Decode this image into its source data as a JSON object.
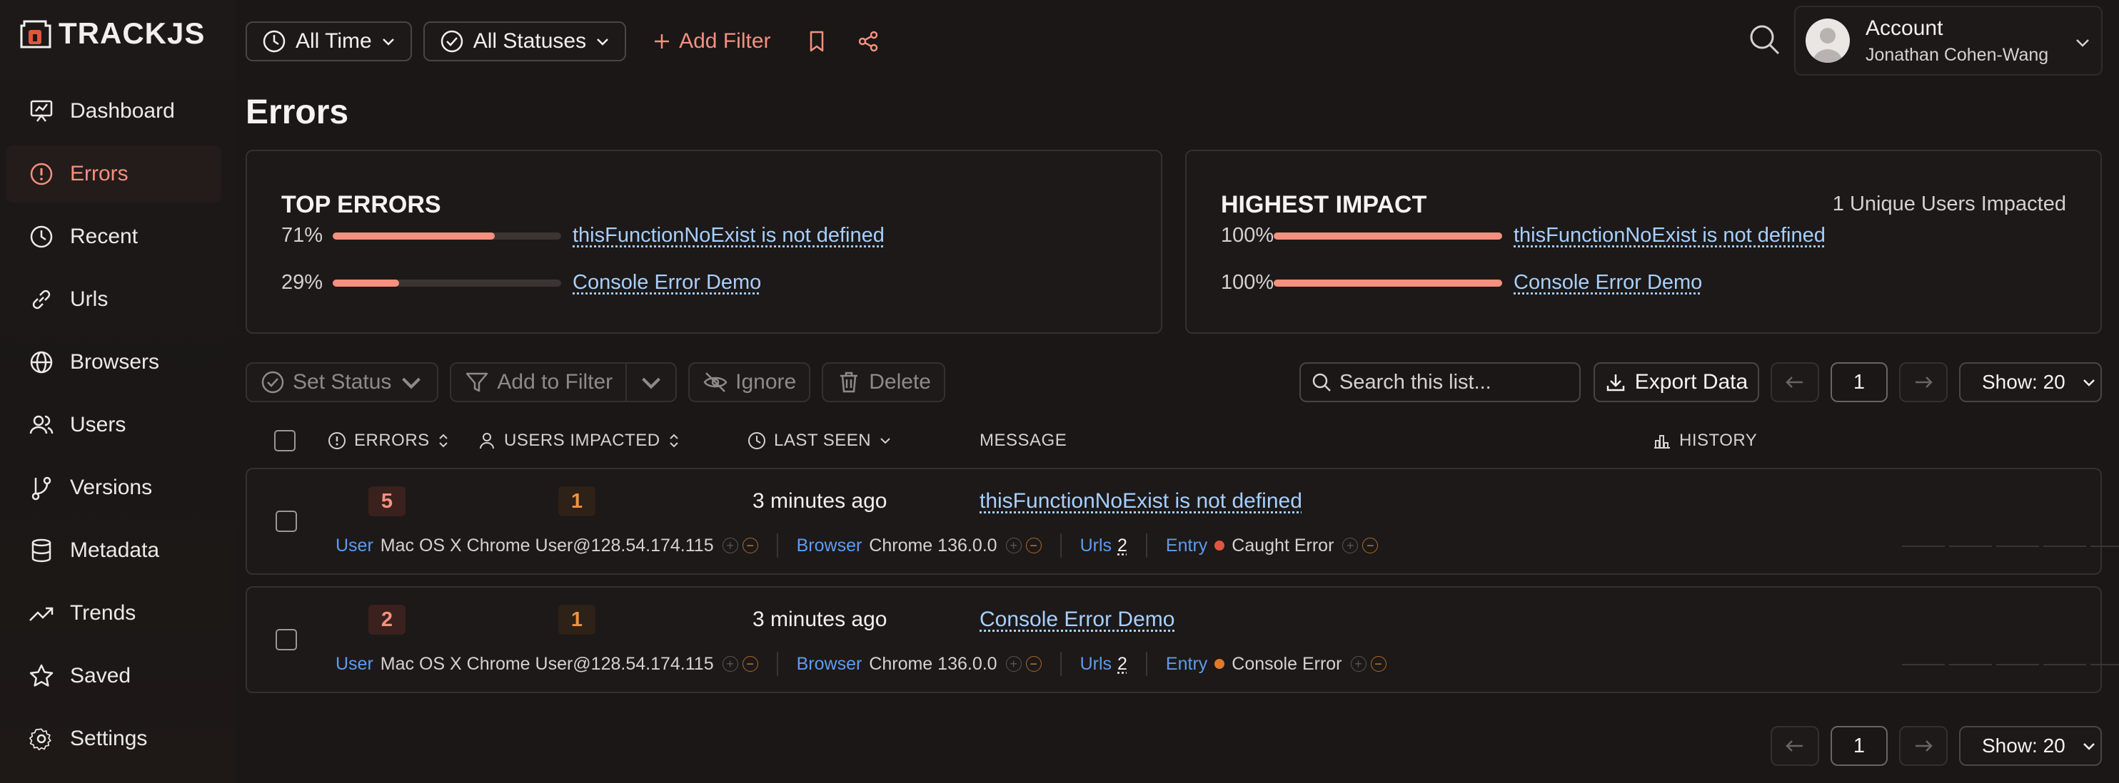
{
  "logo": {
    "text_track": "TRACK",
    "text_js": "JS"
  },
  "sidebar": {
    "items": [
      {
        "label": "Dashboard"
      },
      {
        "label": "Errors"
      },
      {
        "label": "Recent"
      },
      {
        "label": "Urls"
      },
      {
        "label": "Browsers"
      },
      {
        "label": "Users"
      },
      {
        "label": "Versions"
      },
      {
        "label": "Metadata"
      },
      {
        "label": "Trends"
      },
      {
        "label": "Saved"
      },
      {
        "label": "Settings"
      }
    ],
    "active": "Errors"
  },
  "topbar": {
    "time_filter": "All Time",
    "status_filter": "All Statuses",
    "add_filter": "Add Filter"
  },
  "account": {
    "title": "Account",
    "name": "Jonathan Cohen-Wang"
  },
  "page": {
    "title": "Errors"
  },
  "top_errors": {
    "title": "TOP ERRORS",
    "rows": [
      {
        "pct_label": "71%",
        "pct": 0.71,
        "label": "thisFunctionNoExist is not defined"
      },
      {
        "pct_label": "29%",
        "pct": 0.29,
        "label": "Console Error Demo"
      }
    ]
  },
  "highest_impact": {
    "title": "HIGHEST IMPACT",
    "subtitle": "1 Unique Users Impacted",
    "rows": [
      {
        "pct_label": "100%",
        "pct": 1.0,
        "label": "thisFunctionNoExist is not defined"
      },
      {
        "pct_label": "100%",
        "pct": 1.0,
        "label": "Console Error Demo"
      }
    ]
  },
  "toolbar": {
    "set_status": "Set Status",
    "add_to_filter": "Add to Filter",
    "ignore": "Ignore",
    "delete": "Delete",
    "search_placeholder": "Search this list...",
    "export": "Export Data"
  },
  "pager": {
    "page": "1",
    "show": "Show: 20"
  },
  "table": {
    "headers": {
      "errors": "ERRORS",
      "users": "USERS IMPACTED",
      "last_seen": "LAST SEEN",
      "message": "MESSAGE",
      "history": "HISTORY"
    },
    "rows": [
      {
        "errors": "5",
        "users": "1",
        "last_seen": "3 minutes ago",
        "message": "thisFunctionNoExist is not defined",
        "user_key": "User",
        "user_val": "Mac OS X Chrome User@128.54.174.115",
        "browser_key": "Browser",
        "browser_val": "Chrome 136.0.0",
        "urls_key": "Urls",
        "urls_val": "2",
        "entry_key": "Entry",
        "entry_val": "Caught Error",
        "entry_color": "#e0553f"
      },
      {
        "errors": "2",
        "users": "1",
        "last_seen": "3 minutes ago",
        "message": "Console Error Demo",
        "user_key": "User",
        "user_val": "Mac OS X Chrome User@128.54.174.115",
        "browser_key": "Browser",
        "browser_val": "Chrome 136.0.0",
        "urls_key": "Urls",
        "urls_val": "2",
        "entry_key": "Entry",
        "entry_val": "Console Error",
        "entry_color": "#e07a2a"
      }
    ]
  },
  "colors": {
    "accent": "#f5907f",
    "link": "#a7cfff",
    "key_blue": "#5d9cf0",
    "bg": "#1a1716"
  }
}
